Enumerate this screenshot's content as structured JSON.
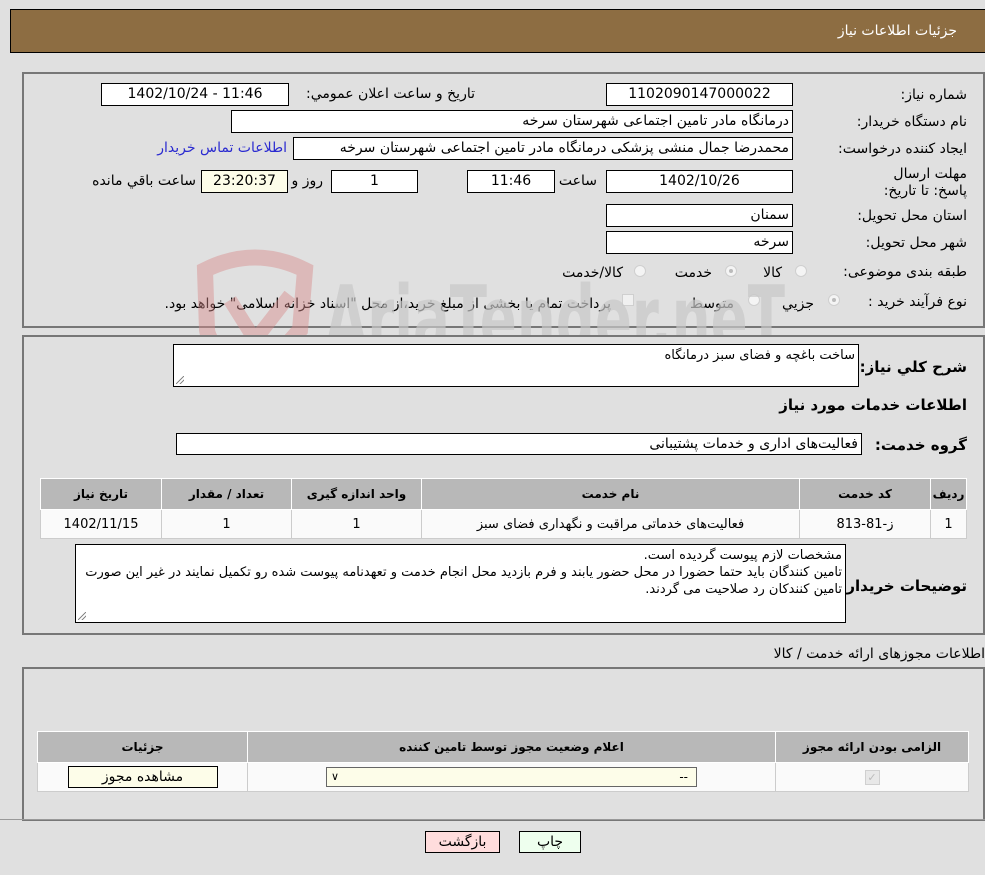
{
  "header": {
    "title": "جزئیات اطلاعات نیاز"
  },
  "form": {
    "need_number_label": "شماره نیاز:",
    "need_number": "1102090147000022",
    "announce_label": "تاریخ و ساعت اعلان عمومي:",
    "announce_value": "1402/10/24 - 11:46",
    "buyer_org_label": "نام دستگاه خریدار:",
    "buyer_org": "درمانگاه مادر تامین اجتماعی شهرستان سرخه",
    "creator_label": "ایجاد کننده درخواست:",
    "creator": "محمدرضا جمال منشی پزشکی درمانگاه مادر تامین اجتماعی شهرستان سرخه",
    "contact_link": "اطلاعات تماس خریدار",
    "deadline_label": "مهلت ارسال پاسخ: تا تاریخ:",
    "deadline_date": "1402/10/26",
    "time_label": "ساعت",
    "deadline_time": "11:46",
    "days_value": "1",
    "days_label": "روز و",
    "remaining_time": "23:20:37",
    "remaining_label": "ساعت باقي مانده",
    "province_label": "استان محل تحویل:",
    "province": "سمنان",
    "city_label": "شهر محل تحویل:",
    "city": "سرخه",
    "category_label": "طبقه بندی موضوعی:",
    "category_options": [
      {
        "label": "کالا",
        "checked": false
      },
      {
        "label": "خدمت",
        "checked": true
      },
      {
        "label": "کالا/خدمت",
        "checked": false
      }
    ],
    "process_label": "نوع فرآیند خرید :",
    "process_options": [
      {
        "label": "جزیي",
        "checked": true
      },
      {
        "label": "متوسط",
        "checked": false
      }
    ],
    "treasury_checkbox_label": "پرداخت تمام یا بخشی از مبلغ خرید،از محل \"اسناد خزانه اسلامی\" خواهد بود.",
    "treasury_checked": false
  },
  "description": {
    "label": "شرح کلي نیاز:",
    "value": "ساخت باغچه و فضای سبز درمانگاه"
  },
  "services": {
    "section_title": "اطلاعات خدمات مورد نیاز",
    "group_label": "گروه خدمت:",
    "group_value": "فعالیت‌های اداری و خدمات پشتیبانی",
    "table": {
      "headers": [
        "ردیف",
        "کد خدمت",
        "نام خدمت",
        "واحد اندازه گیری",
        "تعداد / مقدار",
        "تاریخ نیاز"
      ],
      "rows": [
        [
          "1",
          "ز-81-813",
          "فعالیت‌های خدماتی مراقبت و نگهداری فضای سبز",
          "1",
          "1",
          "1402/11/15"
        ]
      ]
    }
  },
  "buyer_notes": {
    "label": "توضیحات خریدار:",
    "lines": [
      "مشخصات لازم پیوست گردیده است.",
      "تامین کنندگان باید حتما حضورا در محل حضور یابند و فرم بازدید محل انجام خدمت و تعهدنامه پیوست شده رو تکمیل نمایند در غیر این صورت تامین کنندکان رد صلاحیت می گردند."
    ]
  },
  "permits": {
    "section_title": "اطلاعات مجوزهای ارائه خدمت / کالا",
    "headers": [
      "الزامی بودن ارائه مجوز",
      "اعلام وضعیت مجوز توسط تامین کننده",
      "جزئیات"
    ],
    "row": {
      "required_checked": true,
      "status_selected": "--",
      "details_button": "مشاهده مجوز"
    }
  },
  "footer": {
    "print_button": "چاپ",
    "back_button": "بازگشت"
  },
  "watermark": {
    "text": "AriaTender.neT"
  }
}
